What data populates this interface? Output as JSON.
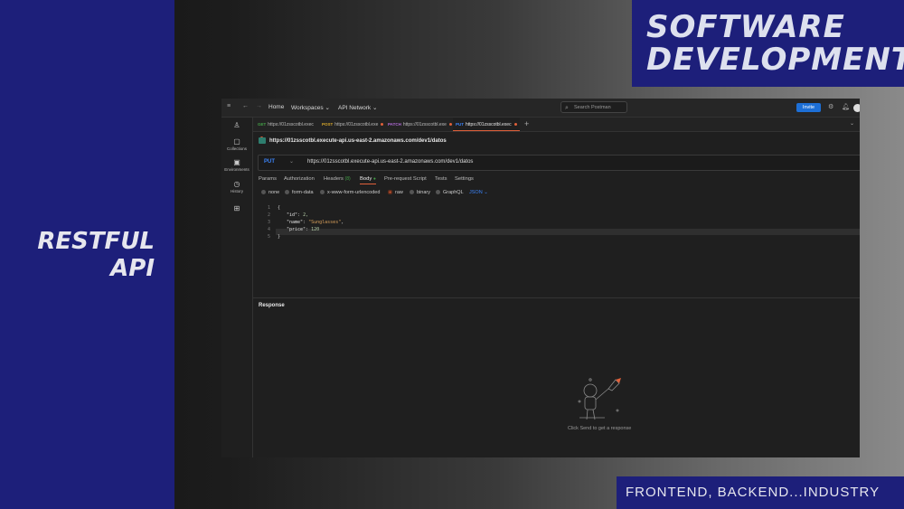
{
  "overlay": {
    "left_title": [
      "RESTFUL",
      "API"
    ],
    "top_banner": [
      "SOFTWARE",
      "DEVELOPMENT"
    ],
    "bottom_banner": "FRONTEND, BACKEND...INDUSTRY"
  },
  "topbar": {
    "menu_icon": "hamburger-icon",
    "home": "Home",
    "workspaces": "Workspaces",
    "api_network": "API Network",
    "search_placeholder": "Search Postman",
    "invite": "Invite"
  },
  "sidebar": {
    "items": [
      {
        "label": "",
        "icon": "user-icon"
      },
      {
        "label": "Collections",
        "icon": "collections-icon"
      },
      {
        "label": "Environments",
        "icon": "environments-icon"
      },
      {
        "label": "History",
        "icon": "history-icon"
      },
      {
        "label": "",
        "icon": "apps-icon"
      }
    ]
  },
  "tabs": [
    {
      "method": "GET",
      "label": "https://01zsscotbl.exec",
      "method_color": "#43a047"
    },
    {
      "method": "POST",
      "label": "https://01zsscotbl.exe",
      "method_color": "#d6a72b"
    },
    {
      "method": "PATCH",
      "label": "https://01zsscotbl.exe",
      "method_color": "#b06ad6"
    },
    {
      "method": "PUT",
      "label": "https://01zsscotbl.exec",
      "method_color": "#3b82f6"
    }
  ],
  "request": {
    "title": "https://01zsscotbl.execute-api.us-east-2.amazonaws.com/dev1/datos",
    "method": "PUT",
    "url": "https://01zsscotbl.execute-api.us-east-2.amazonaws.com/dev1/datos"
  },
  "subtabs": [
    "Params",
    "Authorization",
    "Headers",
    "(8)",
    "Body",
    "Pre-request Script",
    "Tests",
    "Settings"
  ],
  "body_options": [
    "none",
    "form-data",
    "x-www-form-urlencoded",
    "raw",
    "binary",
    "GraphQL",
    "JSON"
  ],
  "code_lines": [
    {
      "n": "1",
      "text": "{"
    },
    {
      "n": "2",
      "key": "\"id\"",
      "val": "2,"
    },
    {
      "n": "3",
      "key": "\"name\"",
      "str": "\"Sunglasses\"",
      "tail": ","
    },
    {
      "n": "4",
      "key": "\"price\"",
      "val": "120"
    },
    {
      "n": "5",
      "text": "}"
    }
  ],
  "response": {
    "label": "Response",
    "hint": "Click Send to get a response",
    "illustration": "astronaut-rocket-illustration"
  },
  "colors": {
    "accent": "#e0603a",
    "put": "#3b82f6",
    "banner": "#1d1f7a"
  }
}
